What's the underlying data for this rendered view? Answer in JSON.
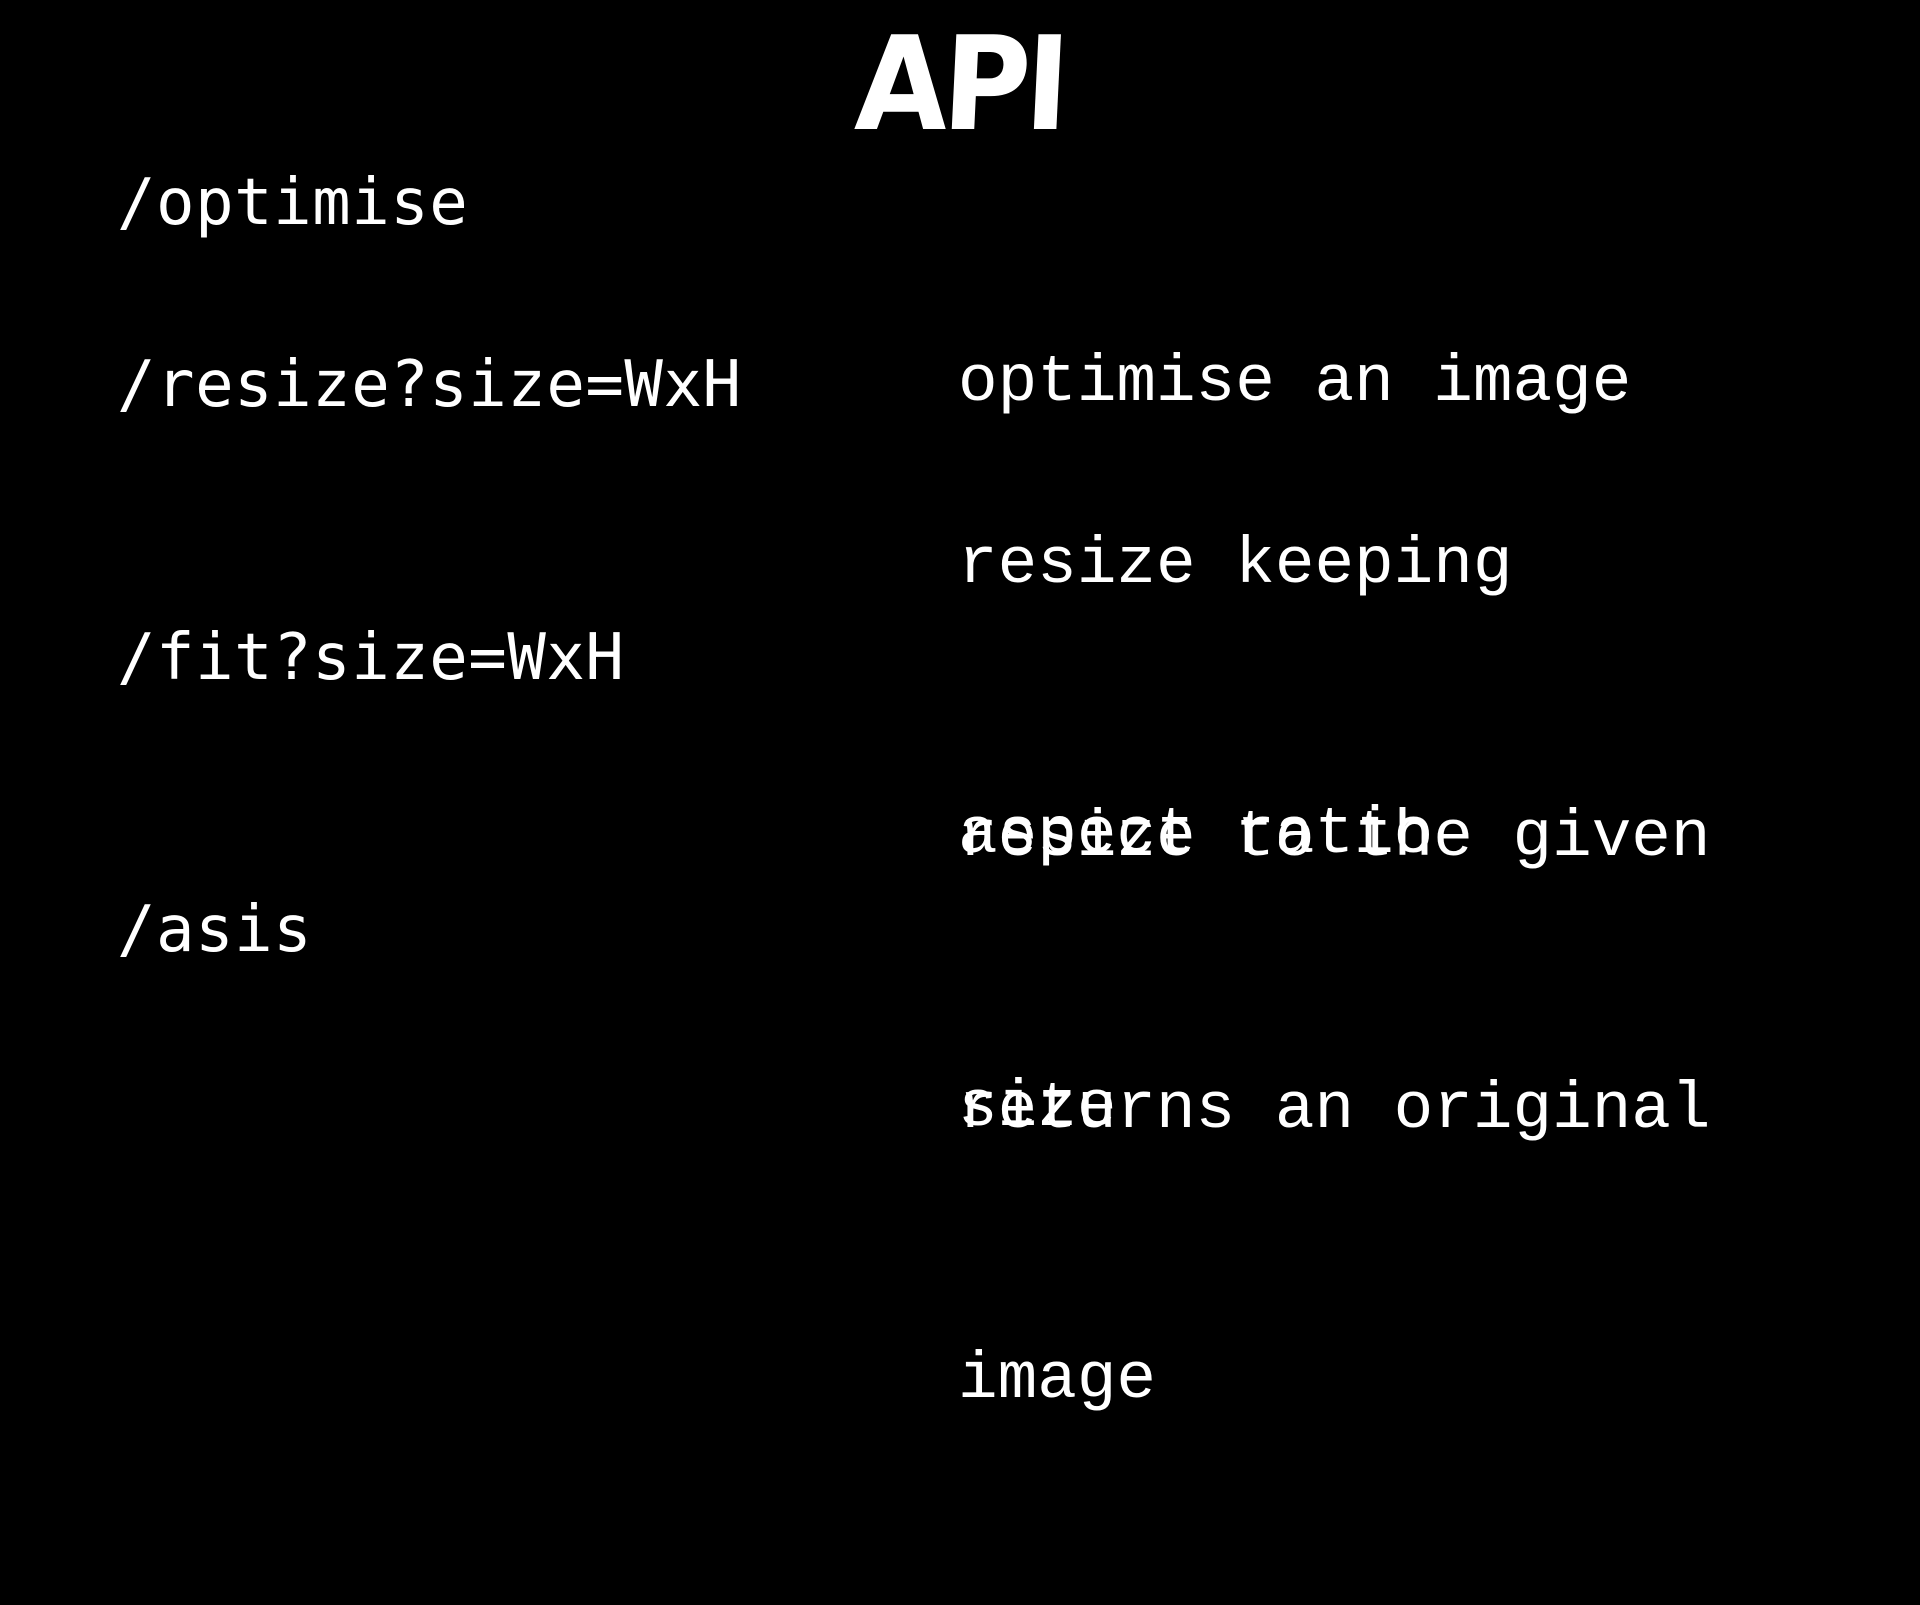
{
  "slide": {
    "title": "API",
    "background_color": "#000000",
    "text_color": "#ffffff",
    "rows": [
      {
        "endpoint": "/optimise",
        "description_lines": [
          "optimise an image"
        ]
      },
      {
        "endpoint": "/resize?size=WxH",
        "description_lines": [
          "resize keeping",
          "aspect ratio"
        ]
      },
      {
        "endpoint": "/fit?size=WxH",
        "description_lines": [
          "resize to the given",
          "size"
        ]
      },
      {
        "endpoint": "/asis",
        "description_lines": [
          "returns an original",
          "image"
        ]
      }
    ]
  }
}
